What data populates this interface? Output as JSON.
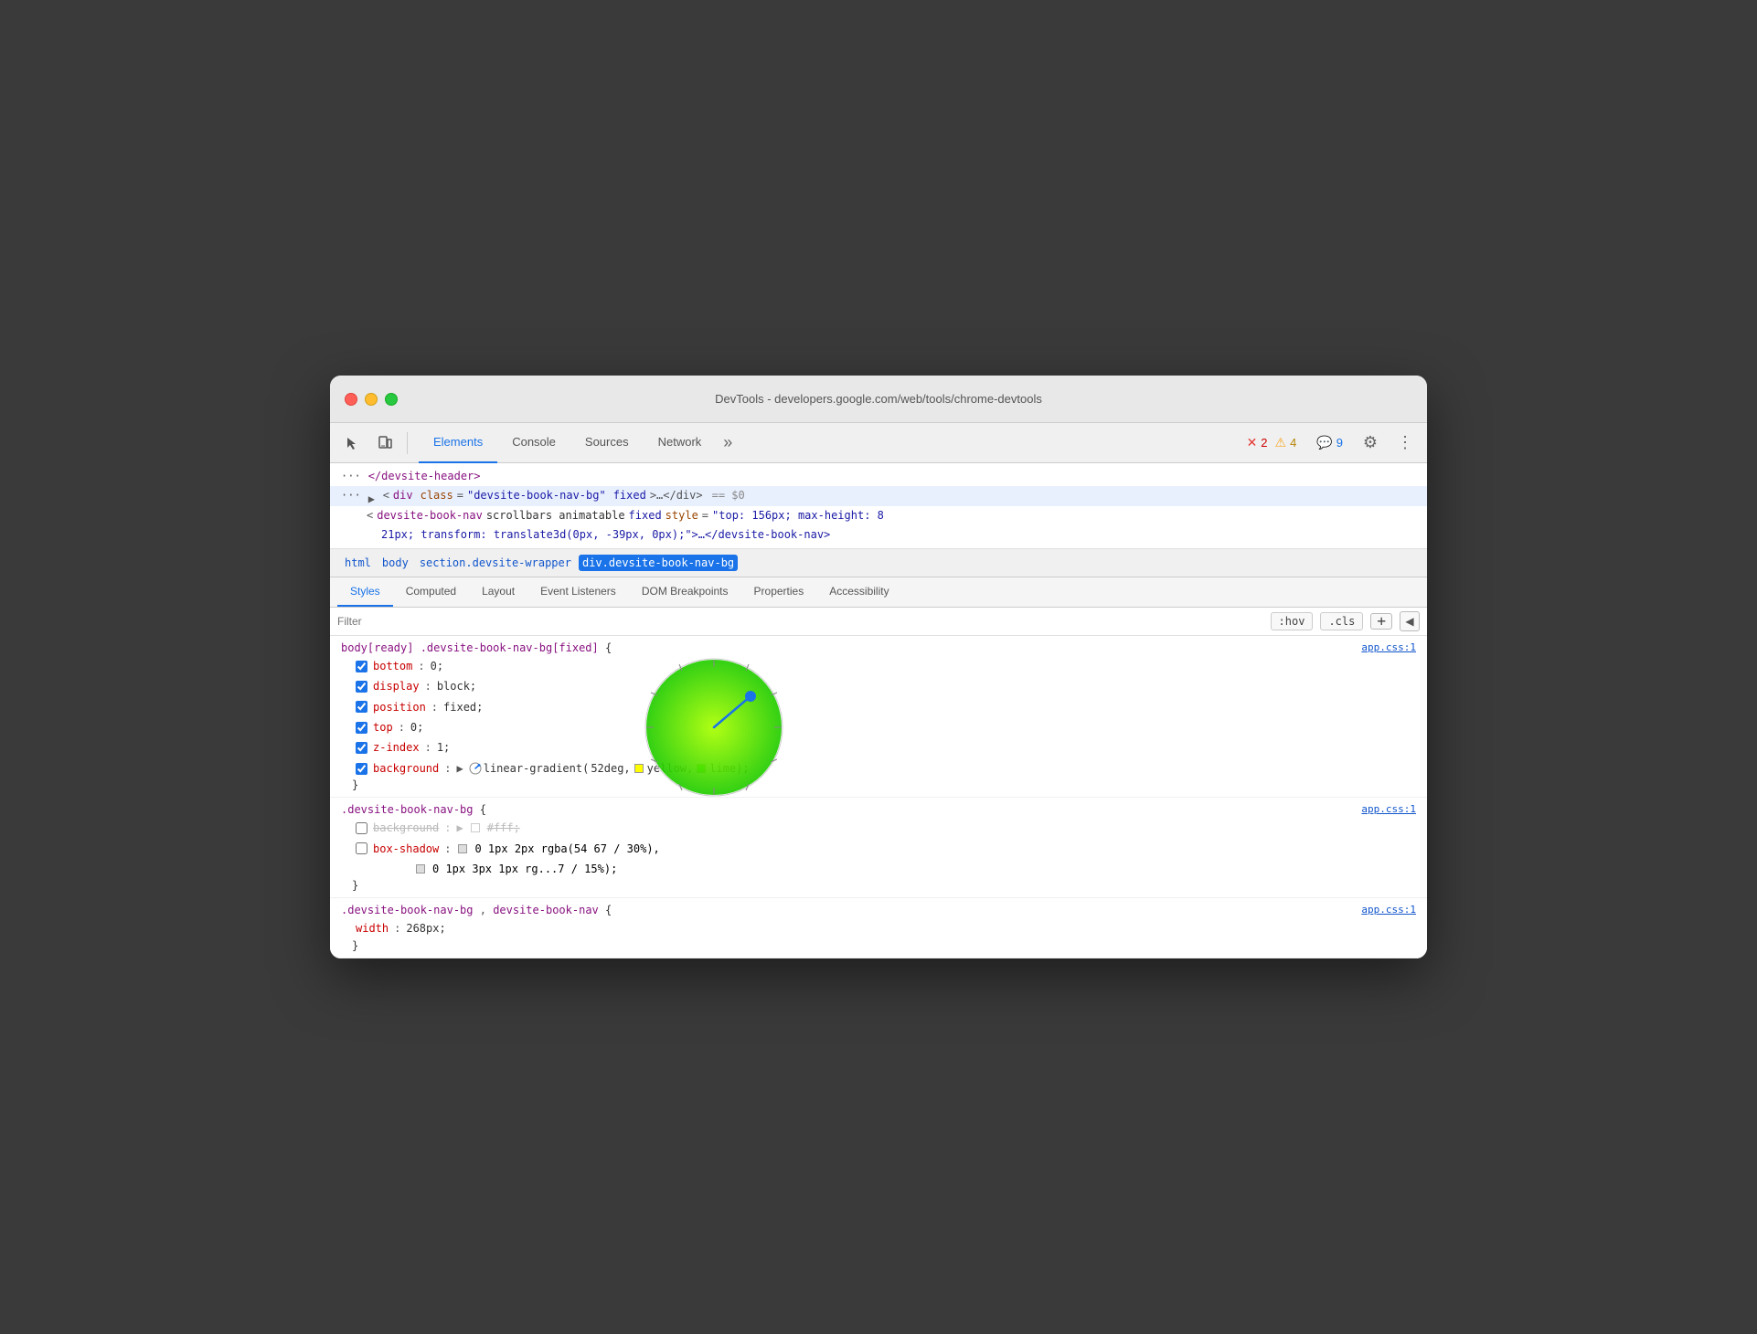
{
  "window": {
    "title": "DevTools - developers.google.com/web/tools/chrome-devtools"
  },
  "toolbar": {
    "tabs": [
      {
        "label": "Elements",
        "active": true
      },
      {
        "label": "Console",
        "active": false
      },
      {
        "label": "Sources",
        "active": false
      },
      {
        "label": "Network",
        "active": false
      }
    ],
    "more_label": "»",
    "badges": {
      "errors": {
        "icon": "✕",
        "count": "2"
      },
      "warnings": {
        "icon": "⚠",
        "count": "4"
      },
      "messages": {
        "icon": "💬",
        "count": "9"
      }
    },
    "gear_icon": "⚙",
    "menu_icon": "⋮"
  },
  "html_panel": {
    "line1": "</devsite-header>",
    "line2_prefix": "▶",
    "line2_tag": "div",
    "line2_attr1_name": "class",
    "line2_attr1_value": "devsite-book-nav-bg",
    "line2_attr2": "fixed",
    "line2_suffix": "…</div>",
    "line2_dom_id": "== $0",
    "line3_tag": "devsite-book-nav",
    "line3_attrs": "scrollbars animatable fixed",
    "line3_style_attr": "style",
    "line3_style_val": "top: 156px; max-height: 8",
    "line4": "21px; transform: translate3d(0px, -39px, 0px);\">…</devsite-book-nav>"
  },
  "breadcrumb": {
    "items": [
      {
        "label": "html",
        "active": false
      },
      {
        "label": "body",
        "active": false
      },
      {
        "label": "section.devsite-wrapper",
        "active": false
      },
      {
        "label": "div.devsite-book-nav-bg",
        "active": true
      }
    ]
  },
  "style_tabs": [
    {
      "label": "Styles",
      "active": true
    },
    {
      "label": "Computed",
      "active": false
    },
    {
      "label": "Layout",
      "active": false
    },
    {
      "label": "Event Listeners",
      "active": false
    },
    {
      "label": "DOM Breakpoints",
      "active": false
    },
    {
      "label": "Properties",
      "active": false
    },
    {
      "label": "Accessibility",
      "active": false
    }
  ],
  "filter": {
    "placeholder": "Filter",
    "hov_label": ":hov",
    "cls_label": ".cls",
    "add_label": "+",
    "toggle_icon": "◀"
  },
  "css_rules": [
    {
      "selector": "body[ready] .devsite-book-nav-bg[fixed] {",
      "source": "app.css:1",
      "properties": [
        {
          "checked": true,
          "name": "bottom",
          "value": "0;",
          "strikethrough": false
        },
        {
          "checked": true,
          "name": "display",
          "value": "block;",
          "strikethrough": false
        },
        {
          "checked": true,
          "name": "position",
          "value": "fixed;",
          "strikethrough": false
        },
        {
          "checked": true,
          "name": "top",
          "value": "0;",
          "strikethrough": false
        },
        {
          "checked": true,
          "name": "z-index",
          "value": "1;",
          "strikethrough": false
        },
        {
          "checked": true,
          "name": "background",
          "value": "linear-gradient(52deg, yellow, lime);",
          "strikethrough": false,
          "has_gradient": true,
          "gradient_angle": "52deg",
          "gradient_color1": "yellow",
          "gradient_color2": "lime"
        }
      ]
    },
    {
      "selector": ".devsite-book-nav-bg {",
      "source": "app.css:1",
      "properties": [
        {
          "checked": false,
          "name": "background",
          "value": "#fff;",
          "strikethrough": true,
          "has_color": true,
          "color": "#ffffff"
        },
        {
          "checked": false,
          "name": "box-shadow",
          "value": "0 1px 2px rgba(54 67 / 30%),",
          "strikethrough": false,
          "has_shadow": true
        },
        {
          "checked": false,
          "name": "",
          "value": "0 1px 3px 1px rg...7 / 15%);",
          "strikethrough": false,
          "has_shadow": true
        }
      ]
    },
    {
      "selector": ".devsite-book-nav-bg, devsite-book-nav {",
      "source": "app.css:1",
      "properties": [
        {
          "checked": false,
          "name": "width",
          "value": "268px;",
          "strikethrough": false
        }
      ]
    }
  ],
  "angle_wheel": {
    "visible": true,
    "angle_deg": 52
  }
}
